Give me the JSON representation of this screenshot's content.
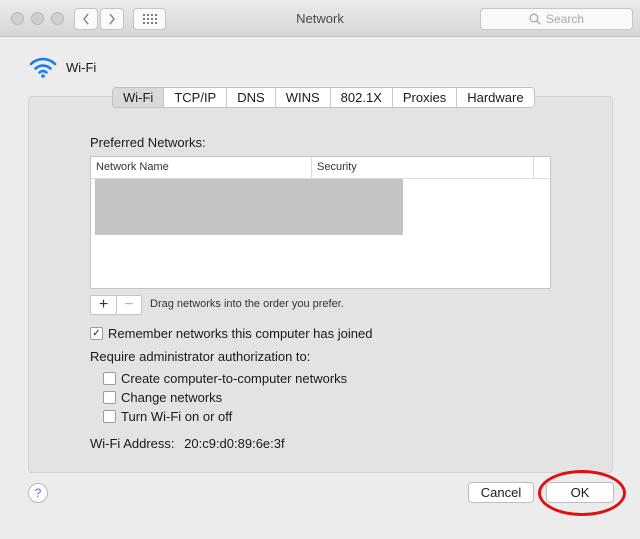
{
  "window": {
    "title": "Network"
  },
  "search": {
    "placeholder": "Search"
  },
  "header": {
    "label": "Wi-Fi"
  },
  "tabs": [
    "Wi-Fi",
    "TCP/IP",
    "DNS",
    "WINS",
    "802.1X",
    "Proxies",
    "Hardware"
  ],
  "active_tab": "Wi-Fi",
  "preferred": {
    "label": "Preferred Networks:",
    "columns": [
      "Network Name",
      "Security"
    ],
    "drag_hint": "Drag networks into the order you prefer."
  },
  "options": {
    "remember": {
      "label": "Remember networks this computer has joined",
      "checked": true
    },
    "require_label": "Require administrator authorization to:",
    "create": {
      "label": "Create computer-to-computer networks",
      "checked": false
    },
    "change": {
      "label": "Change networks",
      "checked": false
    },
    "turn": {
      "label": "Turn Wi-Fi on or off",
      "checked": false
    }
  },
  "address": {
    "label": "Wi-Fi Address:",
    "value": "20:c9:d0:89:6e:3f"
  },
  "buttons": {
    "help": "?",
    "cancel": "Cancel",
    "ok": "OK"
  },
  "colors": {
    "highlight": "#e01010",
    "wifi_icon": "#1a7cf0",
    "help_icon": "#3b7be0"
  }
}
